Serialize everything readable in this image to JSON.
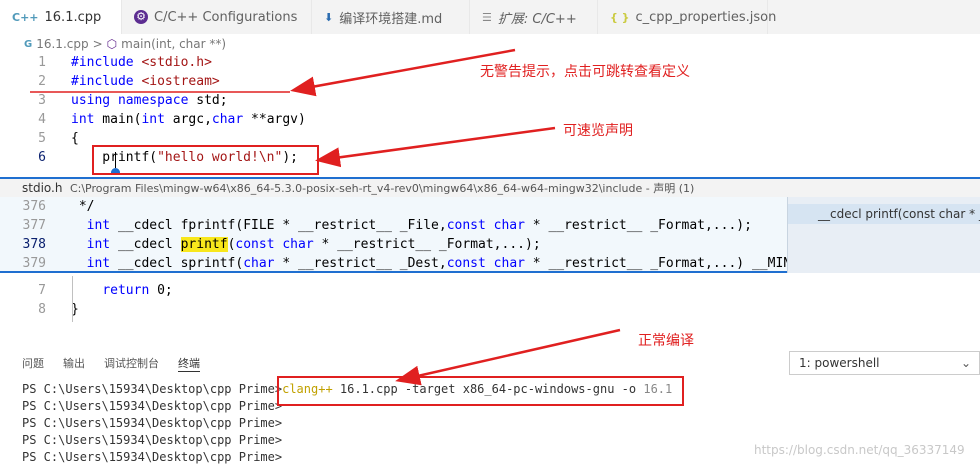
{
  "tabs": [
    {
      "icon": "C++",
      "label": "16.1.cpp",
      "active": true
    },
    {
      "icon": "gear",
      "label": "C/C++ Configurations"
    },
    {
      "icon": "download",
      "label": "编译环境搭建.md"
    },
    {
      "icon": "extension",
      "label": "扩展: C/C++"
    },
    {
      "icon": "{ }",
      "label": "c_cpp_properties.json"
    }
  ],
  "breadcrumb": {
    "file": "16.1.cpp",
    "separator": ">",
    "symbol": "main(int, char **)"
  },
  "editor_lines": [
    {
      "num": "1",
      "html": "<span class=\"pp\">#include</span> <span class=\"inc\">&lt;stdio.h&gt;</span>"
    },
    {
      "num": "2",
      "html": "<span class=\"pp\">#include</span> <span class=\"inc\">&lt;iostream&gt;</span>"
    },
    {
      "num": "3",
      "html": "<span class=\"kw\">using</span> <span class=\"kw\">namespace</span> std;"
    },
    {
      "num": "4",
      "html": "<span class=\"kw\">int</span> main(<span class=\"kw\">int</span> argc,<span class=\"kw\">char</span> **argv)"
    },
    {
      "num": "5",
      "html": "{"
    },
    {
      "num": "6",
      "html": "    printf(<span class=\"str\">\"hello world!\\n\"</span>);"
    }
  ],
  "peek": {
    "filename": "stdio.h",
    "path": "C:\\Program Files\\mingw-w64\\x86_64-5.3.0-posix-seh-rt_v4-rev0\\mingw64\\x86_64-w64-mingw32\\include",
    "suffix": "- 声明 (1)",
    "lines": [
      {
        "num": "376",
        "html": " */"
      },
      {
        "num": "377",
        "html": "  <span class=\"kw\">int</span> __cdecl fprintf(FILE * __restrict__ _File,<span class=\"kw\">const</span> <span class=\"kw\">char</span> * __restrict__ _Format,...);"
      },
      {
        "num": "378",
        "html": "  <span class=\"kw\">int</span> __cdecl <span class=\"hl\">printf</span>(<span class=\"kw\">const</span> <span class=\"kw\">char</span> * __restrict__ _Format,...);"
      },
      {
        "num": "379",
        "html": "  <span class=\"kw\">int</span> __cdecl sprintf(<span class=\"kw\">char</span> * __restrict__ _Dest,<span class=\"kw\">const</span> <span class=\"kw\">char</span> * __restrict__ _Format,...) __MING"
      }
    ],
    "reference": "__cdecl printf(const char * __rest"
  },
  "editor_lines_after": [
    {
      "num": "7",
      "html": "    <span class=\"kw\">return</span> 0;"
    },
    {
      "num": "8",
      "html": "}"
    }
  ],
  "panel": {
    "tabs": [
      "问题",
      "输出",
      "调试控制台",
      "终端"
    ],
    "terminal_select": "1: powershell",
    "prompt": "PS C:\\Users\\15934\\Desktop\\cpp Prime>",
    "command": {
      "compiler": "clang++",
      "args": " 16.1.cpp -target x86_64-pc-windows-gnu -o ",
      "out": "16.1"
    },
    "prompt_lines": 4
  },
  "annotations": {
    "note1": "无警告提示，点击可跳转查看定义",
    "note2": "可速览声明",
    "note3": "正常编译"
  },
  "watermark": "https://blog.csdn.net/qq_36337149",
  "colors": {
    "annotation": "#e02020",
    "accent": "#1f6fd0"
  }
}
